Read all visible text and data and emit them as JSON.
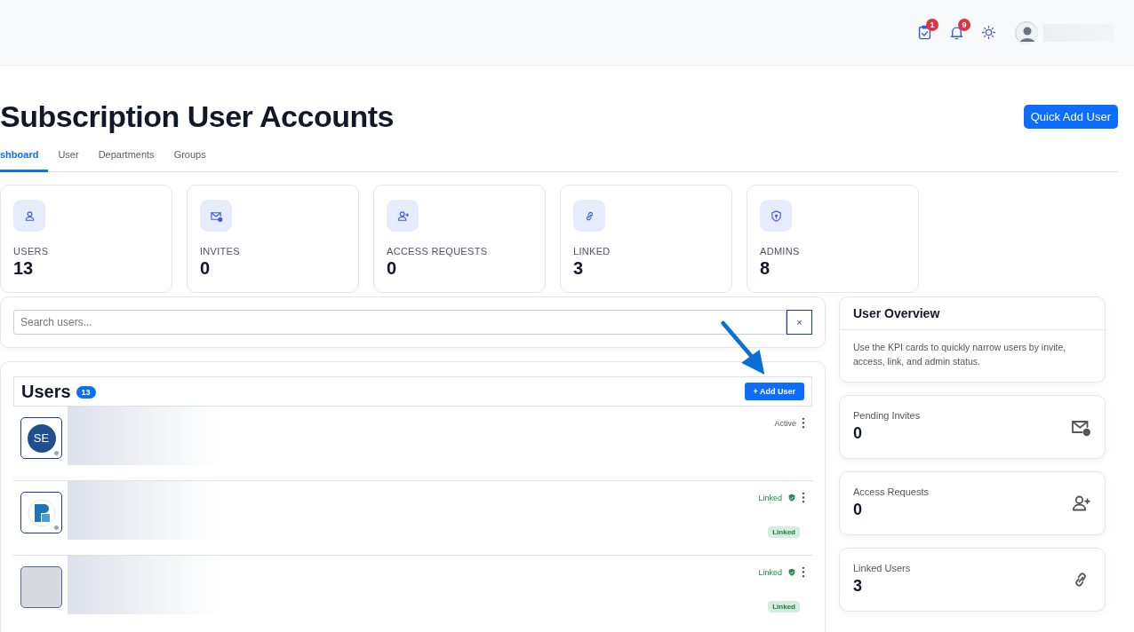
{
  "header": {
    "actions": [
      {
        "kind": "tasks",
        "badge": "1"
      },
      {
        "kind": "notifications",
        "badge": "9"
      },
      {
        "kind": "theme"
      }
    ]
  },
  "page": {
    "title": "Subscription User Accounts",
    "quick_add_button": "Quick Add User"
  },
  "tabs": [
    {
      "label": "shboard",
      "selected": true
    },
    {
      "label": "User",
      "selected": false
    },
    {
      "label": "Departments",
      "selected": false
    },
    {
      "label": "Groups",
      "selected": false
    }
  ],
  "kpi_cards": [
    {
      "kind": "user",
      "label": "USERS",
      "value": "13"
    },
    {
      "kind": "mail",
      "label": "INVITES",
      "value": "0"
    },
    {
      "kind": "user-plus",
      "label": "ACCESS REQUESTS",
      "value": "0"
    },
    {
      "kind": "link",
      "label": "LINKED",
      "value": "3"
    },
    {
      "kind": "shield",
      "label": "ADMINS",
      "value": "8"
    }
  ],
  "search": {
    "placeholder": "Search users...",
    "clear": "×"
  },
  "users": {
    "title": "Users",
    "count": "13",
    "add_button": "+ Add User",
    "rows": [
      {
        "avatar": {
          "kind": "initials",
          "initials": "SE",
          "online": false
        },
        "status": "Active",
        "kind": "active"
      },
      {
        "avatar": {
          "kind": "logo",
          "online": false
        },
        "status": "Linked",
        "kind": "linked",
        "badge": "Linked"
      },
      {
        "avatar": {
          "kind": "blank"
        },
        "status": "Linked",
        "kind": "linked",
        "badge": "Linked"
      }
    ]
  },
  "overview": {
    "title": "User Overview",
    "text": "Use the KPI cards to quickly narrow users by invite, access, link, and admin status.",
    "stats": [
      {
        "kind": "mail",
        "label": "Pending Invites",
        "value": "0"
      },
      {
        "kind": "user-plus",
        "label": "Access Requests",
        "value": "0"
      },
      {
        "kind": "link",
        "label": "Linked Users",
        "value": "3"
      }
    ]
  }
}
